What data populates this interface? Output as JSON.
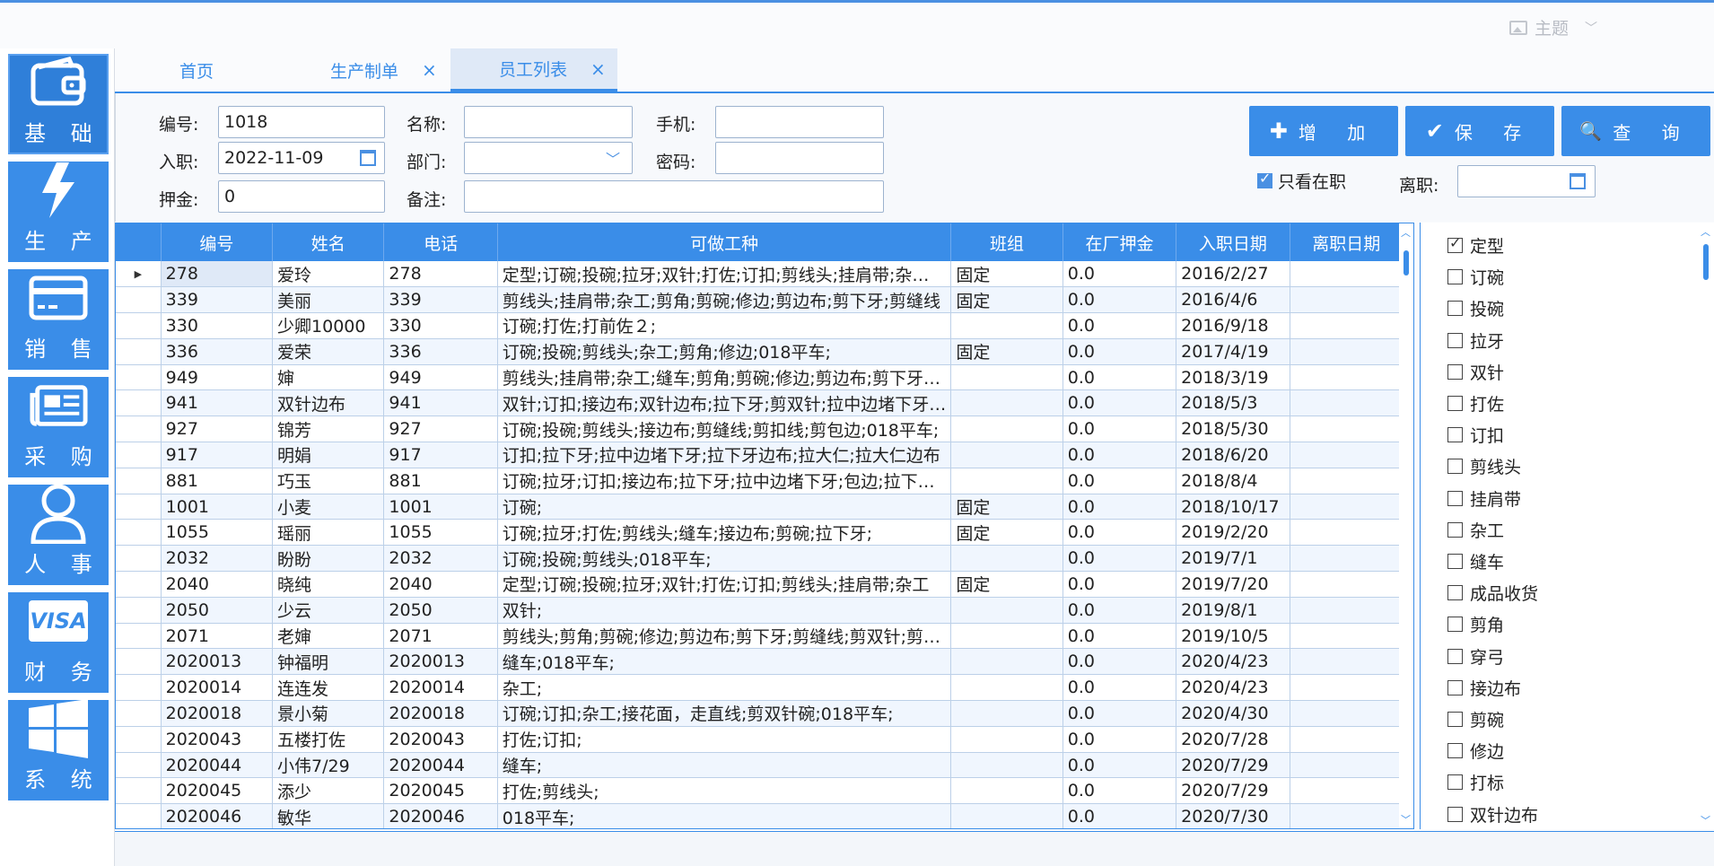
{
  "header": {
    "theme_label": "主题"
  },
  "nav": {
    "items": [
      {
        "label": "基 础",
        "icon": "wallet-icon"
      },
      {
        "label": "生 产",
        "icon": "lightning-icon"
      },
      {
        "label": "销 售",
        "icon": "card-icon"
      },
      {
        "label": "采 购",
        "icon": "newspaper-icon"
      },
      {
        "label": "人 事",
        "icon": "user-icon"
      },
      {
        "label": "财 务",
        "icon": "visa-icon"
      },
      {
        "label": "系 统",
        "icon": "windows-icon"
      }
    ],
    "visa_text": "VISA"
  },
  "tabs": [
    {
      "label": "首页"
    },
    {
      "label": "生产制单"
    },
    {
      "label": "员工列表"
    }
  ],
  "tab_close": "×",
  "form": {
    "id_label": "编号:",
    "id_value": "1018",
    "name_label": "名称:",
    "name_value": "",
    "phone_label": "手机:",
    "phone_value": "",
    "join_label": "入职:",
    "join_value": "2022-11-09",
    "dept_label": "部门:",
    "dept_value": "",
    "pwd_label": "密码:",
    "pwd_value": "",
    "deposit_label": "押金:",
    "deposit_value": "0",
    "remark_label": "备注:",
    "remark_value": "",
    "only_active_label": "只看在职",
    "leave_label": "离职:",
    "leave_value": ""
  },
  "buttons": {
    "add": "增 加",
    "add_icon": "✚",
    "save": "保 存",
    "save_icon": "✔",
    "query": "查 询",
    "query_icon": "🔍"
  },
  "table": {
    "columns": [
      "编号",
      "姓名",
      "电话",
      "可做工种",
      "班组",
      "在厂押金",
      "入职日期",
      "离职日期"
    ],
    "rows": [
      [
        "278",
        "爱玲",
        "278",
        "定型;订碗;投碗;拉牙;双针;打佐;订扣;剪线头;挂肩带;杂工;缝车",
        "固定",
        "0.0",
        "2016/2/27",
        ""
      ],
      [
        "339",
        "美丽",
        "339",
        "剪线头;挂肩带;杂工;剪角;剪碗;修边;剪边布;剪下牙;剪缝线",
        "固定",
        "0.0",
        "2016/4/6",
        ""
      ],
      [
        "330",
        "少卿10000",
        "330",
        "订碗;打佐;打前佐２;",
        "",
        "0.0",
        "2016/9/18",
        ""
      ],
      [
        "336",
        "爱荣",
        "336",
        "订碗;投碗;剪线头;杂工;剪角;修边;018平车;",
        "固定",
        "0.0",
        "2017/4/19",
        ""
      ],
      [
        "949",
        "婶",
        "949",
        "剪线头;挂肩带;杂工;缝车;剪角;剪碗;修边;剪边布;剪下牙;剪缝线",
        "",
        "0.0",
        "2018/3/19",
        ""
      ],
      [
        "941",
        "双针边布",
        "941",
        "双针;订扣;接边布;双针边布;拉下牙;剪双针;拉中边堵下牙;包边",
        "",
        "0.0",
        "2018/5/3",
        ""
      ],
      [
        "927",
        "锦芳",
        "927",
        "订碗;投碗;剪线头;接边布;剪缝线;剪扣线;剪包边;018平车;",
        "",
        "0.0",
        "2018/5/30",
        ""
      ],
      [
        "917",
        "明娟",
        "917",
        "订扣;拉下牙;拉中边堵下牙;拉下牙边布;拉大仁;拉大仁边布",
        "",
        "0.0",
        "2018/6/20",
        ""
      ],
      [
        "881",
        "巧玉",
        "881",
        "订碗;拉牙;订扣;接边布;拉下牙;拉中边堵下牙;包边;拉下牙边布",
        "",
        "0.0",
        "2018/8/4",
        ""
      ],
      [
        "1001",
        "小麦",
        "1001",
        "订碗;",
        "固定",
        "0.0",
        "2018/10/17",
        ""
      ],
      [
        "1055",
        "瑶丽",
        "1055",
        "订碗;拉牙;打佐;剪线头;缝车;接边布;剪碗;拉下牙;",
        "固定",
        "0.0",
        "2019/2/20",
        ""
      ],
      [
        "2032",
        "盼盼",
        "2032",
        "订碗;投碗;剪线头;018平车;",
        "",
        "0.0",
        "2019/7/1",
        ""
      ],
      [
        "2040",
        "晓纯",
        "2040",
        "定型;订碗;投碗;拉牙;双针;打佐;订扣;剪线头;挂肩带;杂工",
        "固定",
        "0.0",
        "2019/7/20",
        ""
      ],
      [
        "2050",
        "少云",
        "2050",
        "双针;",
        "",
        "0.0",
        "2019/8/1",
        ""
      ],
      [
        "2071",
        "老婶",
        "2071",
        "剪线头;剪角;剪碗;修边;剪边布;剪下牙;剪缝线;剪双针;剪扣线",
        "",
        "0.0",
        "2019/10/5",
        ""
      ],
      [
        "2020013",
        "钟福明",
        "2020013",
        "缝车;018平车;",
        "",
        "0.0",
        "2020/4/23",
        ""
      ],
      [
        "2020014",
        "连连发",
        "2020014",
        "杂工;",
        "",
        "0.0",
        "2020/4/23",
        ""
      ],
      [
        "2020018",
        "景小菊",
        "2020018",
        "订碗;订扣;杂工;接花面，走直线;剪双针碗;018平车;",
        "",
        "0.0",
        "2020/4/30",
        ""
      ],
      [
        "2020043",
        "五楼打佐",
        "2020043",
        "打佐;订扣;",
        "",
        "0.0",
        "2020/7/28",
        ""
      ],
      [
        "2020044",
        "小伟7/29",
        "2020044",
        "缝车;",
        "",
        "0.0",
        "2020/7/29",
        ""
      ],
      [
        "2020045",
        "添少",
        "2020045",
        "打佐;剪线头;",
        "",
        "0.0",
        "2020/7/29",
        ""
      ],
      [
        "2020046",
        "敏华",
        "2020046",
        "018平车;",
        "",
        "0.0",
        "2020/7/30",
        ""
      ]
    ]
  },
  "work_types": [
    {
      "label": "定型",
      "checked": true
    },
    {
      "label": "订碗",
      "checked": false
    },
    {
      "label": "投碗",
      "checked": false
    },
    {
      "label": "拉牙",
      "checked": false
    },
    {
      "label": "双针",
      "checked": false
    },
    {
      "label": "打佐",
      "checked": false
    },
    {
      "label": "订扣",
      "checked": false
    },
    {
      "label": "剪线头",
      "checked": false
    },
    {
      "label": "挂肩带",
      "checked": false
    },
    {
      "label": "杂工",
      "checked": false
    },
    {
      "label": "缝车",
      "checked": false
    },
    {
      "label": "成品收货",
      "checked": false
    },
    {
      "label": "剪角",
      "checked": false
    },
    {
      "label": "穿弓",
      "checked": false
    },
    {
      "label": "接边布",
      "checked": false
    },
    {
      "label": "剪碗",
      "checked": false
    },
    {
      "label": "修边",
      "checked": false
    },
    {
      "label": "打标",
      "checked": false
    },
    {
      "label": "双针边布",
      "checked": false
    }
  ],
  "colors": {
    "accent": "#3a8de8",
    "stripe": "#f0f6fe"
  }
}
